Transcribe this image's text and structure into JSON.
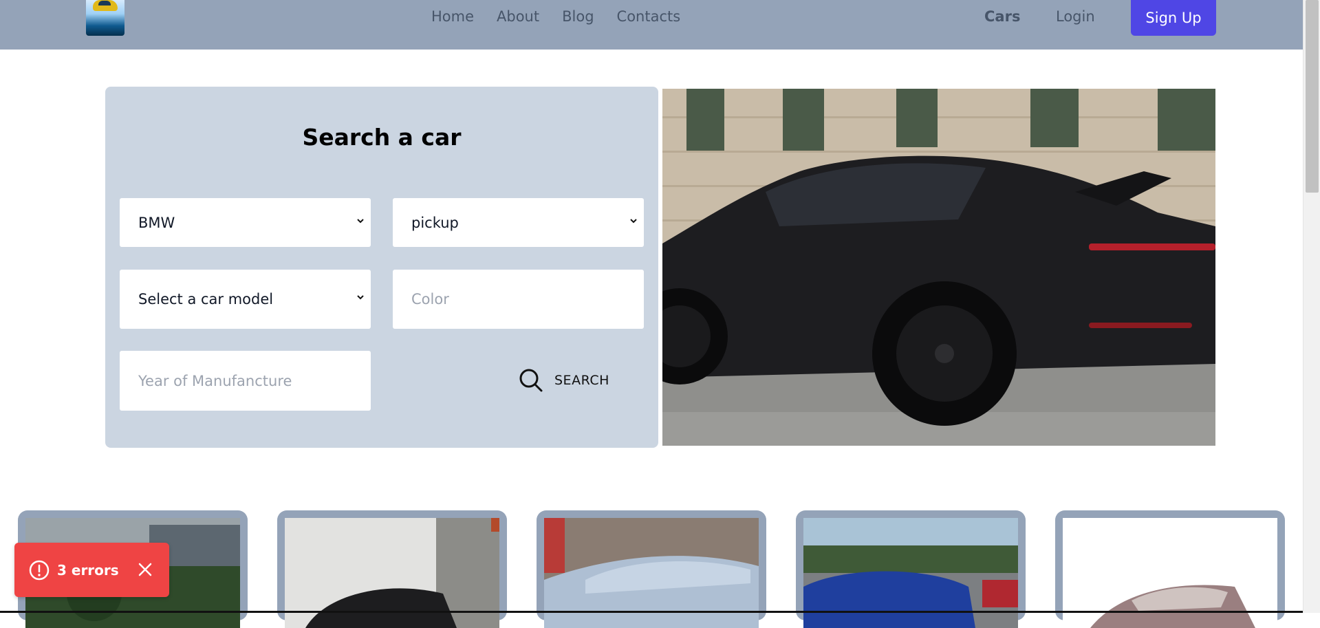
{
  "nav": {
    "links": [
      {
        "label": "Home"
      },
      {
        "label": "About"
      },
      {
        "label": "Blog"
      },
      {
        "label": "Contacts"
      }
    ],
    "cars_label": "Cars",
    "login_label": "Login",
    "signup_label": "Sign Up"
  },
  "search": {
    "title": "Search a car",
    "make_value": "BMW",
    "type_value": "pickup",
    "model_value": "Select a car model",
    "color_placeholder": "Color",
    "year_placeholder": "Year of Manufancture",
    "button_label": "SEARCH"
  },
  "toast": {
    "text": "3 errors"
  },
  "colors": {
    "navbar": "#94a3b8",
    "accent": "#4f46e5",
    "panel": "#cbd5e1",
    "error": "#ef4444"
  },
  "icons": {
    "search": "search-icon",
    "chevron": "chevron-down-icon",
    "alert": "alert-circle-icon",
    "close": "close-icon"
  }
}
